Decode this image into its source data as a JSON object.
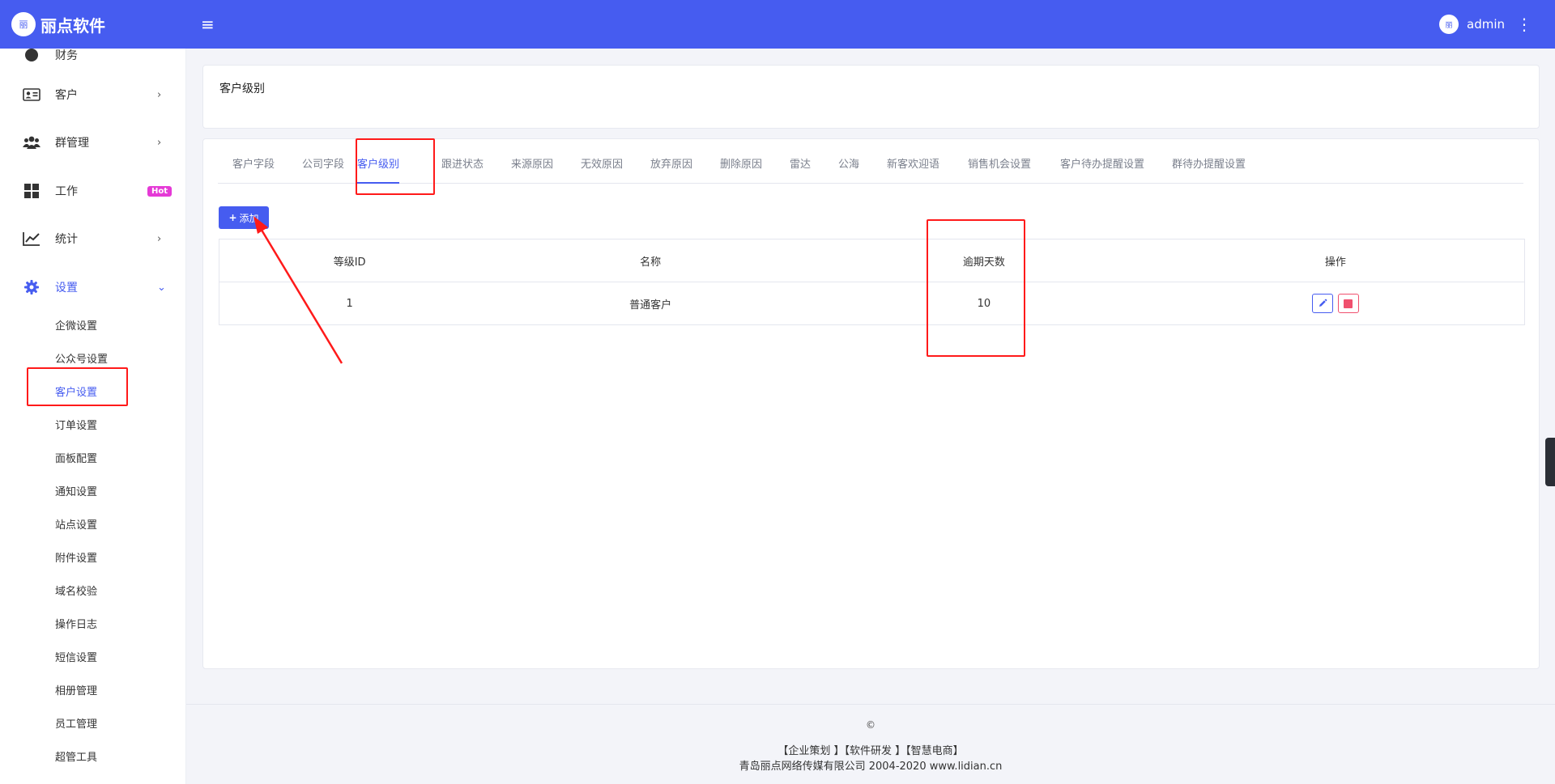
{
  "header": {
    "logo_badge": "丽",
    "logo_text": "丽点软件",
    "menu_icon": "≡",
    "user_avatar": "丽",
    "user_name": "admin",
    "more_icon": "⋮"
  },
  "sidebar": {
    "items": [
      {
        "label": "财务",
        "icon": "circle-icon"
      },
      {
        "label": "客户",
        "icon": "id-card-icon",
        "arrow": "›"
      },
      {
        "label": "群管理",
        "icon": "users-icon",
        "arrow": "›"
      },
      {
        "label": "工作",
        "icon": "grid-icon",
        "badge": "Hot"
      },
      {
        "label": "统计",
        "icon": "line-chart-icon",
        "arrow": "›"
      },
      {
        "label": "设置",
        "icon": "gear-icon",
        "arrow": "⌄"
      }
    ],
    "sub_items": [
      "企微设置",
      "公众号设置",
      "客户设置",
      "订单设置",
      "面板配置",
      "通知设置",
      "站点设置",
      "附件设置",
      "域名校验",
      "操作日志",
      "短信设置",
      "相册管理",
      "员工管理",
      "超管工具"
    ]
  },
  "page": {
    "title": "客户级别"
  },
  "tabs": [
    "客户字段",
    "公司字段",
    "客户级别",
    "跟进状态",
    "来源原因",
    "无效原因",
    "放弃原因",
    "删除原因",
    "雷达",
    "公海",
    "新客欢迎语",
    "销售机会设置",
    "客户待办提醒设置",
    "群待办提醒设置"
  ],
  "add_button": {
    "plus": "+",
    "label": "添加"
  },
  "table": {
    "headers": [
      "等级ID",
      "名称",
      "逾期天数",
      "操作"
    ],
    "rows": [
      {
        "id": "1",
        "name": "普通客户",
        "days": "10"
      }
    ]
  },
  "footer": {
    "copyright": "©",
    "links": "【企业策划 】【软件研发 】【智慧电商】",
    "company": "青岛丽点网络传媒有限公司 2004-2020 www.lidian.cn"
  },
  "colors": {
    "accent": "#465cf0",
    "annotation": "#ff1a1a",
    "hot": "#e53ad6",
    "danger": "#f0506e"
  }
}
